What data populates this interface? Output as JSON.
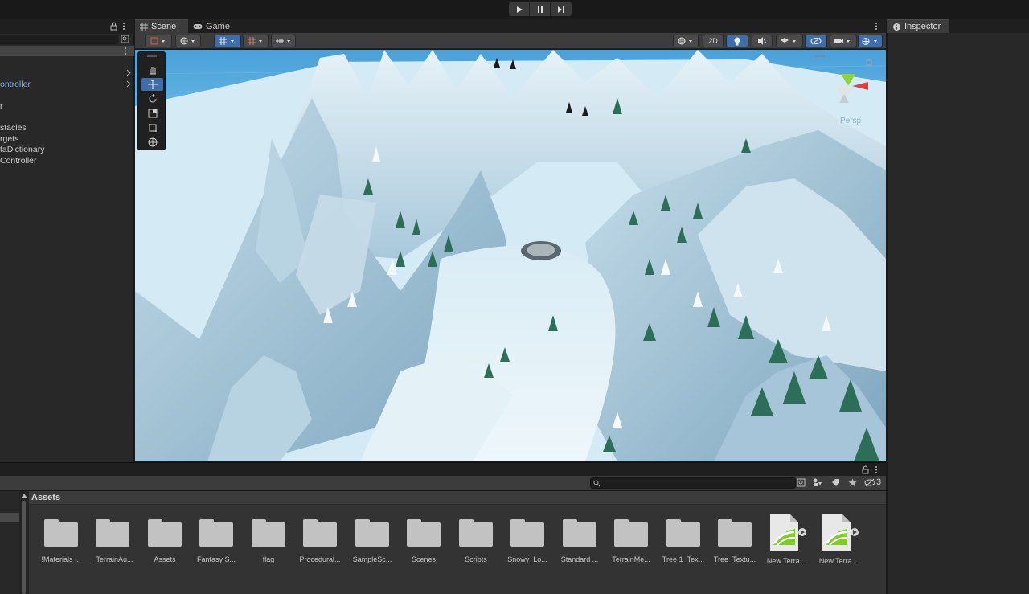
{
  "topbar": {
    "controls": [
      "play-icon",
      "pause-icon",
      "step-icon"
    ]
  },
  "hierarchy": {
    "items": [
      {
        "label": "ontroller",
        "highlight": true
      },
      {
        "label": "r",
        "highlight": false
      },
      {
        "label": "stacles",
        "highlight": false
      },
      {
        "label": "rgets",
        "highlight": false
      },
      {
        "label": "taDictionary",
        "highlight": false
      },
      {
        "label": "Controller",
        "highlight": false
      }
    ]
  },
  "scene": {
    "tabs": [
      {
        "label": "Scene",
        "icon": "grid-icon",
        "active": true
      },
      {
        "label": "Game",
        "icon": "gamepad-icon",
        "active": false
      }
    ],
    "mode_2d_label": "2D",
    "persp_label": "Persp"
  },
  "inspector": {
    "tab_label": "Inspector",
    "icon": "info-icon"
  },
  "project": {
    "breadcrumb": "Assets",
    "hidden_count": "3",
    "assets": [
      {
        "name": "!Materials ...",
        "type": "folder"
      },
      {
        "name": "_TerrainAu...",
        "type": "folder"
      },
      {
        "name": "Assets",
        "type": "folder"
      },
      {
        "name": "Fantasy S...",
        "type": "folder"
      },
      {
        "name": "flag",
        "type": "folder"
      },
      {
        "name": "Procedural...",
        "type": "folder"
      },
      {
        "name": "SampleSc...",
        "type": "folder"
      },
      {
        "name": "Scenes",
        "type": "folder"
      },
      {
        "name": "Scripts",
        "type": "folder"
      },
      {
        "name": "Snowy_Lo...",
        "type": "folder"
      },
      {
        "name": "Standard ...",
        "type": "folder"
      },
      {
        "name": "TerrainMe...",
        "type": "folder"
      },
      {
        "name": "Tree 1_Tex...",
        "type": "folder"
      },
      {
        "name": "Tree_Textu...",
        "type": "folder"
      },
      {
        "name": "New Terra...",
        "type": "terrain"
      },
      {
        "name": "New Terra...",
        "type": "terrain"
      }
    ]
  },
  "colors": {
    "accent": "#3e6ea9",
    "panel": "#282828",
    "toolbar": "#3c3c3c",
    "link": "#7cb1ec"
  }
}
